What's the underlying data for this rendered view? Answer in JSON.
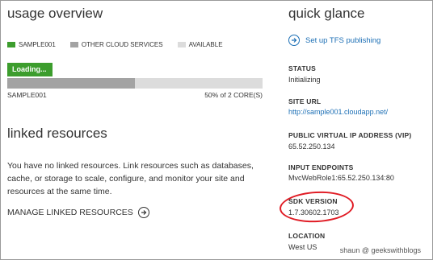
{
  "usage": {
    "title": "usage overview",
    "legend": [
      {
        "label": "SAMPLE001",
        "color": "#3c9d2d"
      },
      {
        "label": "OTHER CLOUD SERVICES",
        "color": "#a3a3a3"
      },
      {
        "label": "AVAILABLE",
        "color": "#dcdcdc"
      }
    ],
    "loading_label": "Loading...",
    "bar": {
      "name": "SAMPLE001",
      "usage_text": "50% of 2 CORE(S)",
      "fill_fraction": 0.5
    }
  },
  "linked": {
    "title": "linked resources",
    "description": "You have no linked resources. Link resources such as databases, cache, or storage to scale, configure, and monitor your site and resources at the same time.",
    "manage_label": "MANAGE LINKED RESOURCES"
  },
  "quick_glance": {
    "title": "quick glance",
    "tfs_link": "Set up TFS publishing",
    "status_label": "STATUS",
    "status_value": "Initializing",
    "site_url_label": "SITE URL",
    "site_url_value": "http://sample001.cloudapp.net/",
    "vip_label": "PUBLIC VIRTUAL IP ADDRESS (VIP)",
    "vip_value": "65.52.250.134",
    "endpoints_label": "INPUT ENDPOINTS",
    "endpoints_value": "MvcWebRole1:65.52.250.134:80",
    "sdk_label": "SDK VERSION",
    "sdk_value": "1.7.30602.1703",
    "location_label": "LOCATION",
    "location_value": "West US"
  },
  "watermark": "shaun @ geekswithblogs",
  "colors": {
    "accent": "#3c9d2d",
    "link": "#1c6fb5",
    "annotation": "#e01b24"
  }
}
